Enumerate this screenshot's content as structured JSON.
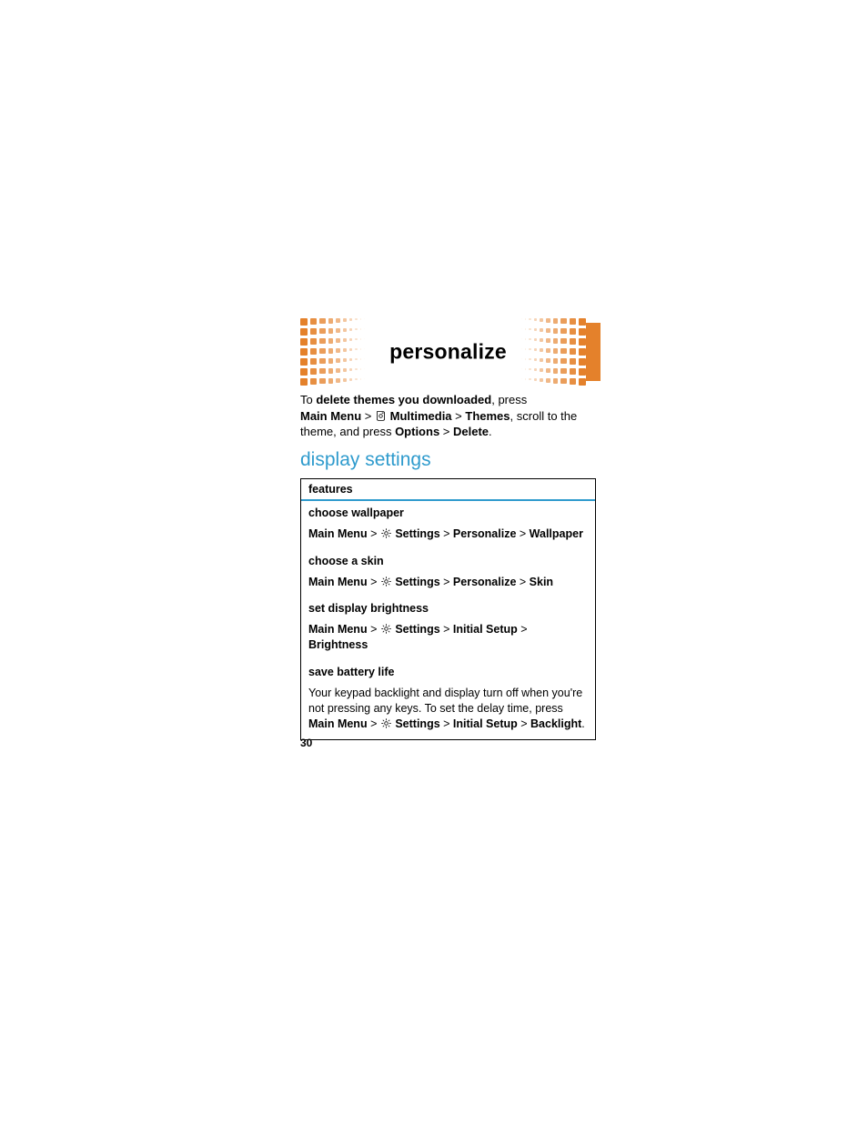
{
  "header": {
    "title": "personalize"
  },
  "intro": {
    "pre_bold": "To ",
    "bold": "delete themes you downloaded",
    "post_bold": ", press ",
    "path_1_a": "Main Menu",
    "path_1_b": "Multimedia",
    "path_1_c": "Themes",
    "mid": ", scroll to the theme, and press ",
    "path_2_a": "Options",
    "path_2_b": "Delete",
    "end": "."
  },
  "section_title": "display settings",
  "table": {
    "head": "features",
    "rows": [
      {
        "title": "choose wallpaper",
        "mm": "Main Menu",
        "p1": "Settings",
        "p2": "Personalize",
        "p3": "Wallpaper",
        "icon": "gear",
        "body_text": null
      },
      {
        "title": "choose a skin",
        "mm": "Main Menu",
        "p1": "Settings",
        "p2": "Personalize",
        "p3": "Skin",
        "icon": "gear",
        "body_text": null
      },
      {
        "title": "set display brightness",
        "mm": "Main Menu",
        "p1": "Settings",
        "p2": "Initial Setup",
        "p3": "Brightness",
        "icon": "gear",
        "body_text": null
      },
      {
        "title": "save battery life",
        "body_text_a": "Your keypad backlight and display turn off when you're not pressing any keys. To set the delay time, press ",
        "mm": "Main Menu",
        "p1": "Settings",
        "p2": "Initial Setup",
        "p3": "Backlight",
        "icon": "gear",
        "trail": "."
      }
    ]
  },
  "page_number": "30"
}
